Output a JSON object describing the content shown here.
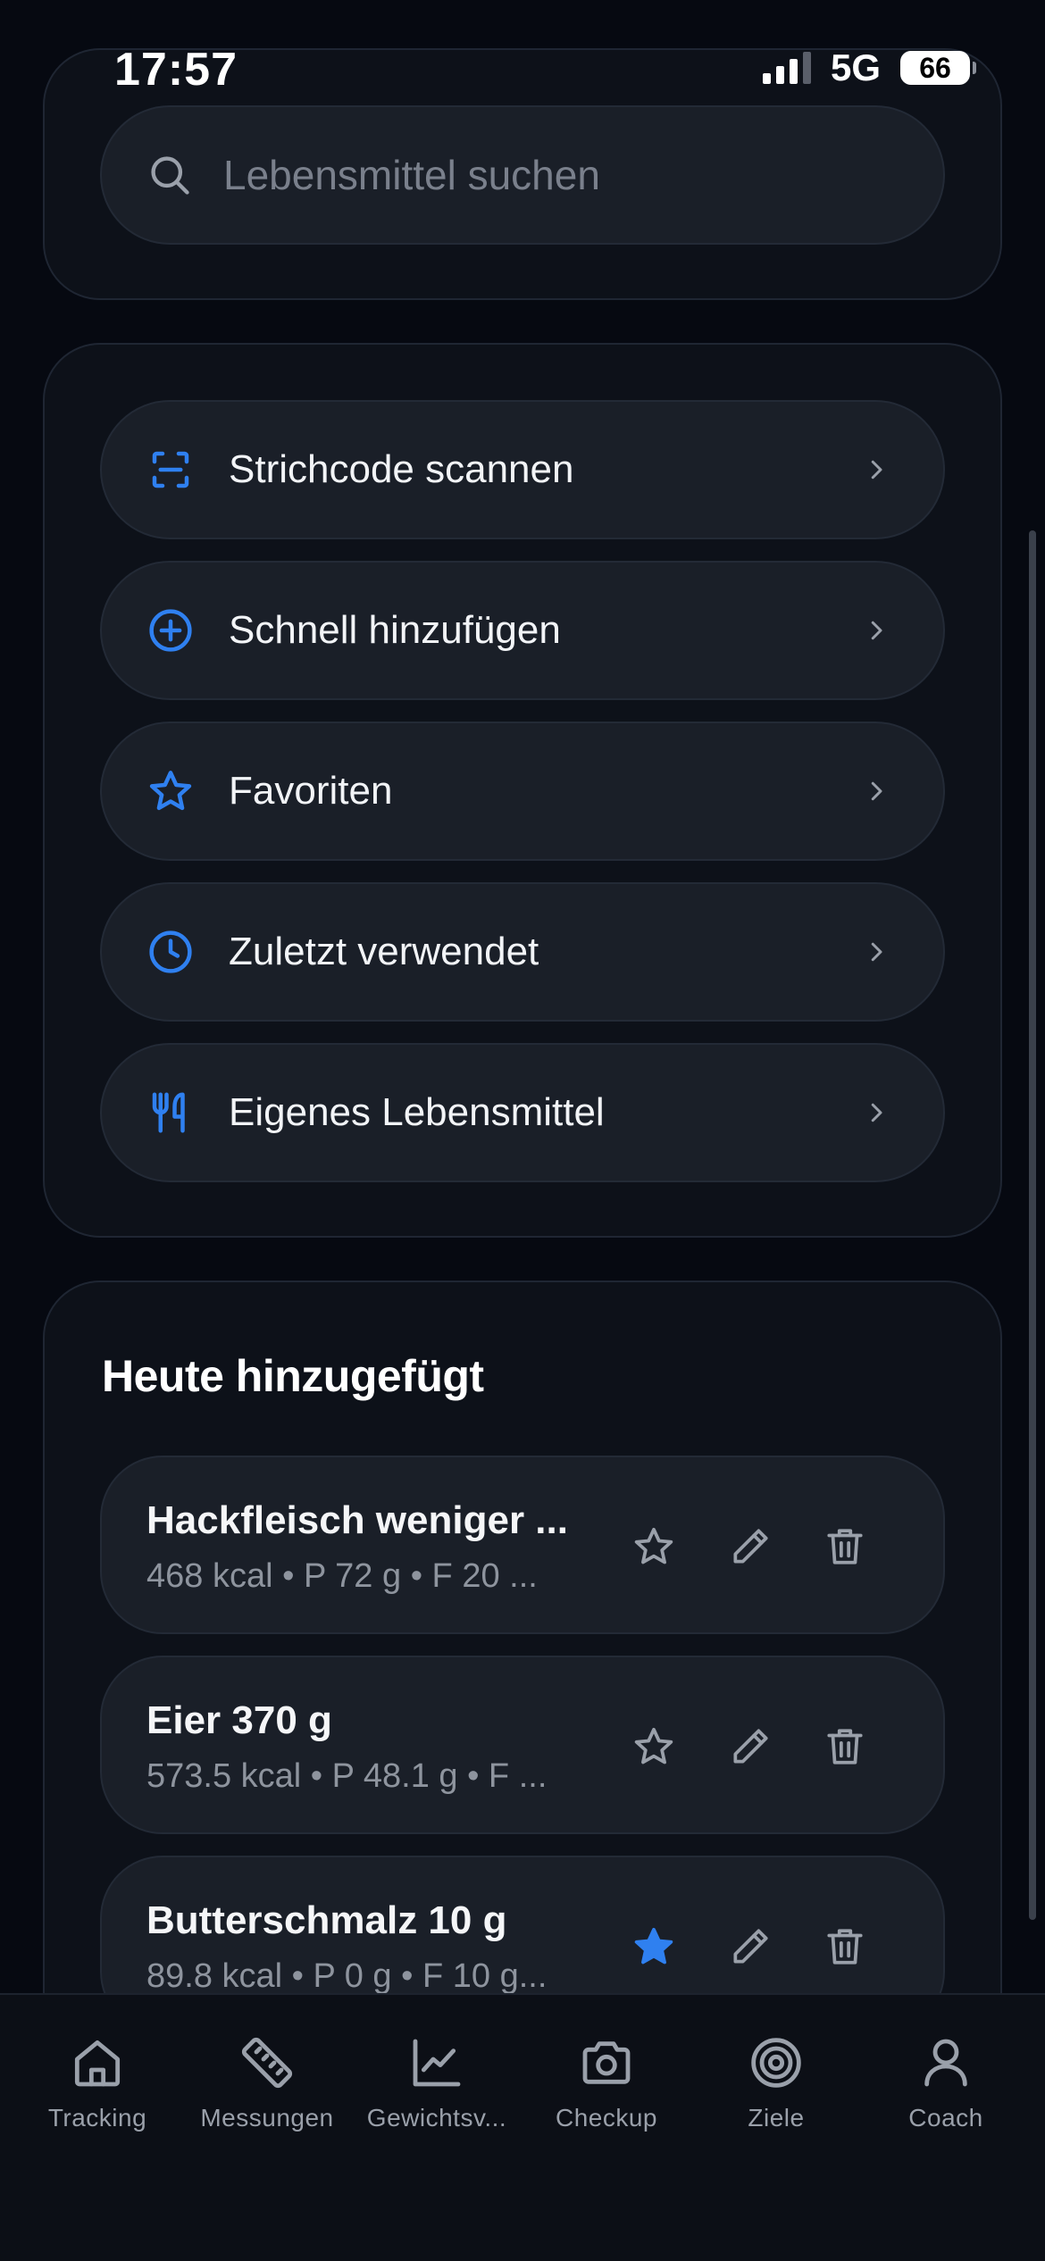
{
  "status_bar": {
    "time": "17:57",
    "network": "5G",
    "battery": "66"
  },
  "search": {
    "placeholder": "Lebensmittel suchen",
    "value": ""
  },
  "actions": [
    {
      "label": "Strichcode scannen",
      "icon": "barcode-scan-icon"
    },
    {
      "label": "Schnell hinzufügen",
      "icon": "plus-circle-icon"
    },
    {
      "label": "Favoriten",
      "icon": "star-icon"
    },
    {
      "label": "Zuletzt verwendet",
      "icon": "clock-icon"
    },
    {
      "label": "Eigenes Lebensmittel",
      "icon": "fork-knife-icon"
    }
  ],
  "today": {
    "title": "Heute hinzugefügt",
    "entries": [
      {
        "name": "Hackfleisch weniger ...",
        "summary": "468 kcal • P 72 g • F 20 ...",
        "favorite": false
      },
      {
        "name": "Eier 370 g",
        "summary": "573.5 kcal • P 48.1 g • F ...",
        "favorite": false
      },
      {
        "name": "Butterschmalz 10 g",
        "summary": "89.8 kcal • P 0 g • F 10 g...",
        "favorite": true
      }
    ]
  },
  "tabs": [
    {
      "label": "Tracking",
      "icon": "home-icon"
    },
    {
      "label": "Messungen",
      "icon": "ruler-icon"
    },
    {
      "label": "Gewichtsv...",
      "icon": "chart-line-icon"
    },
    {
      "label": "Checkup",
      "icon": "camera-icon"
    },
    {
      "label": "Ziele",
      "icon": "target-icon"
    },
    {
      "label": "Coach",
      "icon": "person-icon"
    }
  ],
  "colors": {
    "accent": "#2f80f0",
    "background": "#060911",
    "card": "#0d1119",
    "row": "#1a1f28",
    "muted": "#8e949e"
  }
}
